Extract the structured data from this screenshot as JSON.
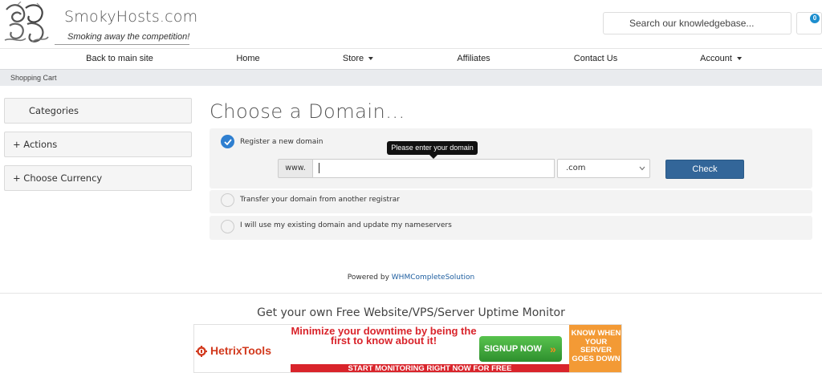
{
  "brand": {
    "name": "SmokyHosts.com",
    "tagline": "Smoking away the competition!"
  },
  "header": {
    "search_placeholder": "Search our knowledgebase...",
    "cart_count": "0"
  },
  "nav": {
    "items": [
      {
        "label": "Back to main site"
      },
      {
        "label": "Home"
      },
      {
        "label": "Store"
      },
      {
        "label": "Affiliates"
      },
      {
        "label": "Contact Us"
      },
      {
        "label": "Account"
      }
    ]
  },
  "breadcrumb": "Shopping Cart",
  "sidebar": {
    "categories": "Categories",
    "actions": "+ Actions",
    "currency": "+ Choose Currency"
  },
  "main": {
    "title": "Choose a Domain...",
    "option_register": "Register a new domain",
    "option_transfer": "Transfer your domain from another registrar",
    "option_existing": "I will use my existing domain and update my nameservers",
    "www_prefix": "www.",
    "domain_value": "",
    "tld_selected": ".com",
    "check_label": "Check",
    "tooltip": "Please enter your domain"
  },
  "powered": {
    "prefix": "Powered by",
    "link": "WHMCompleteSolution"
  },
  "footer": {
    "title": "Get your own Free Website/VPS/Server Uptime Monitor"
  },
  "banner": {
    "logo": "HetrixTools",
    "headline": "Minimize your downtime by being the first to know about it!",
    "signup": "SIGNUP NOW",
    "arrows": "»",
    "right_text": "KNOW WHEN YOUR SERVER GOES DOWN",
    "bottom": "START MONITORING RIGHT NOW FOR FREE"
  },
  "colors": {
    "accent": "#336699",
    "radio_checked": "#2f7fd0",
    "badge": "#1d8ece",
    "banner_red": "#d9242b",
    "banner_orange": "#f39a35",
    "banner_green": "#3fa83a"
  }
}
